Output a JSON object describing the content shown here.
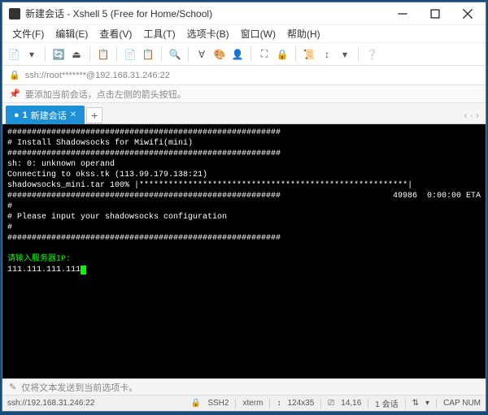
{
  "titlebar": {
    "text": "新建会话 - Xshell 5 (Free for Home/School)"
  },
  "menu": {
    "file": "文件(F)",
    "edit": "编辑(E)",
    "view": "查看(V)",
    "tool": "工具(T)",
    "tab": "选项卡(B)",
    "window": "窗口(W)",
    "help": "帮助(H)"
  },
  "addressbar": {
    "text": "ssh://root*******@192.168.31.246:22"
  },
  "infobar": {
    "text": "要添加当前会话，点击左侧的箭头按钮。"
  },
  "tabs": {
    "active_num": "1",
    "active_label": "新建会话",
    "add": "+"
  },
  "terminal": {
    "hash": "########################################################",
    "l1": "# Install Shadowsocks for Miwifi(mini)",
    "l2": "sh: 0: unknown operand",
    "l3": "Connecting to okss.tk (113.99.179.138:21)",
    "l4a": "shadowsocks_mini.tar 100% |",
    "l4b": "*******************************************************|",
    "l4c": " 49986  0:00:00 ETA",
    "l5": "#",
    "l6": "# Please input your shadowsocks configuration",
    "l7": "#",
    "l8": "请输入服务器IP:",
    "l9": "111.111.111.111"
  },
  "bottom": {
    "hint": "仅将文本发送到当前选项卡。"
  },
  "status": {
    "conn": "ssh://192.168.31.246:22",
    "proto": "SSH2",
    "term": "xterm",
    "size": "124x35",
    "pos": "14,16",
    "sess": "1 会话",
    "caps": "CAP  NUM"
  },
  "icons": {
    "lock": "🔒",
    "info": "ℹ",
    "pin": "📌",
    "dot": "●",
    "chev": "‹ · ›"
  },
  "chart_data": {
    "type": "table",
    "title": "Xshell terminal output",
    "lines": [
      "########################################################",
      "# Install Shadowsocks for Miwifi(mini)",
      "########################################################",
      "sh: 0: unknown operand",
      "Connecting to okss.tk (113.99.179.138:21)",
      "shadowsocks_mini.tar 100% |*******************************************************| 49986  0:00:00 ETA",
      "########################################################",
      "#",
      "# Please input your shadowsocks configuration",
      "#",
      "########################################################",
      "",
      "请输入服务器IP:",
      "111.111.111.111"
    ]
  }
}
